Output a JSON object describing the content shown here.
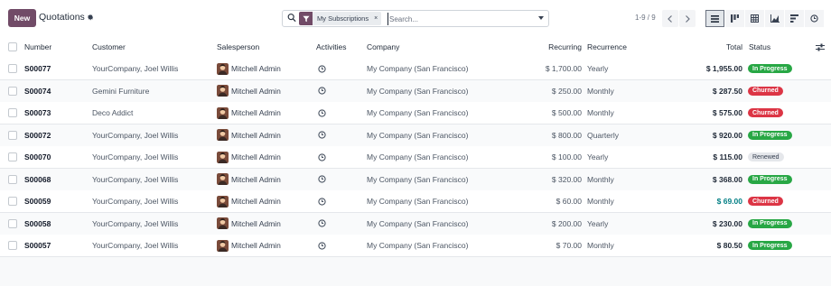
{
  "control_panel": {
    "new_label": "New",
    "title": "Quotations",
    "search": {
      "facet_label": "My Subscriptions",
      "facet_remove": "×",
      "placeholder": "Search..."
    },
    "pager": "1-9 / 9",
    "views": [
      "list-icon",
      "kanban-icon",
      "calendar-icon",
      "graph-icon",
      "pivot-icon",
      "activity-icon"
    ]
  },
  "columns": {
    "number": "Number",
    "customer": "Customer",
    "salesperson": "Salesperson",
    "activities": "Activities",
    "company": "Company",
    "recurring": "Recurring",
    "recurrence": "Recurrence",
    "total": "Total",
    "status": "Status"
  },
  "rows": [
    {
      "number": "S00077",
      "customer": "YourCompany, Joel Willis",
      "salesperson": "Mitchell Admin",
      "company": "My Company (San Francisco)",
      "recurring": "$ 1,700.00",
      "recurrence": "Yearly",
      "total": "$ 1,955.00",
      "status": "In Progress"
    },
    {
      "number": "S00074",
      "customer": "Gemini Furniture",
      "salesperson": "Mitchell Admin",
      "company": "My Company (San Francisco)",
      "recurring": "$ 250.00",
      "recurrence": "Monthly",
      "total": "$ 287.50",
      "status": "Churned"
    },
    {
      "number": "S00073",
      "customer": "Deco Addict",
      "salesperson": "Mitchell Admin",
      "company": "My Company (San Francisco)",
      "recurring": "$ 500.00",
      "recurrence": "Monthly",
      "total": "$ 575.00",
      "status": "Churned"
    },
    {
      "number": "S00072",
      "customer": "YourCompany, Joel Willis",
      "salesperson": "Mitchell Admin",
      "company": "My Company (San Francisco)",
      "recurring": "$ 800.00",
      "recurrence": "Quarterly",
      "total": "$ 920.00",
      "status": "In Progress"
    },
    {
      "number": "S00070",
      "customer": "YourCompany, Joel Willis",
      "salesperson": "Mitchell Admin",
      "company": "My Company (San Francisco)",
      "recurring": "$ 100.00",
      "recurrence": "Yearly",
      "total": "$ 115.00",
      "status": "Renewed"
    },
    {
      "number": "S00068",
      "customer": "YourCompany, Joel Willis",
      "salesperson": "Mitchell Admin",
      "company": "My Company (San Francisco)",
      "recurring": "$ 320.00",
      "recurrence": "Monthly",
      "total": "$ 368.00",
      "status": "In Progress"
    },
    {
      "number": "S00059",
      "customer": "YourCompany, Joel Willis",
      "salesperson": "Mitchell Admin",
      "company": "My Company (San Francisco)",
      "recurring": "$ 60.00",
      "recurrence": "Monthly",
      "total": "$ 69.00",
      "status": "Churned"
    },
    {
      "number": "S00058",
      "customer": "YourCompany, Joel Willis",
      "salesperson": "Mitchell Admin",
      "company": "My Company (San Francisco)",
      "recurring": "$ 200.00",
      "recurrence": "Yearly",
      "total": "$ 230.00",
      "status": "In Progress"
    },
    {
      "number": "S00057",
      "customer": "YourCompany, Joel Willis",
      "salesperson": "Mitchell Admin",
      "company": "My Company (San Francisco)",
      "recurring": "$ 70.00",
      "recurrence": "Monthly",
      "total": "$ 80.50",
      "status": "In Progress"
    }
  ],
  "colors": {
    "brand": "#714b67",
    "in_progress": "#28a745",
    "churned": "#dc3545",
    "renewed": "#e5e7eb",
    "highlight_total": "#017e84"
  }
}
